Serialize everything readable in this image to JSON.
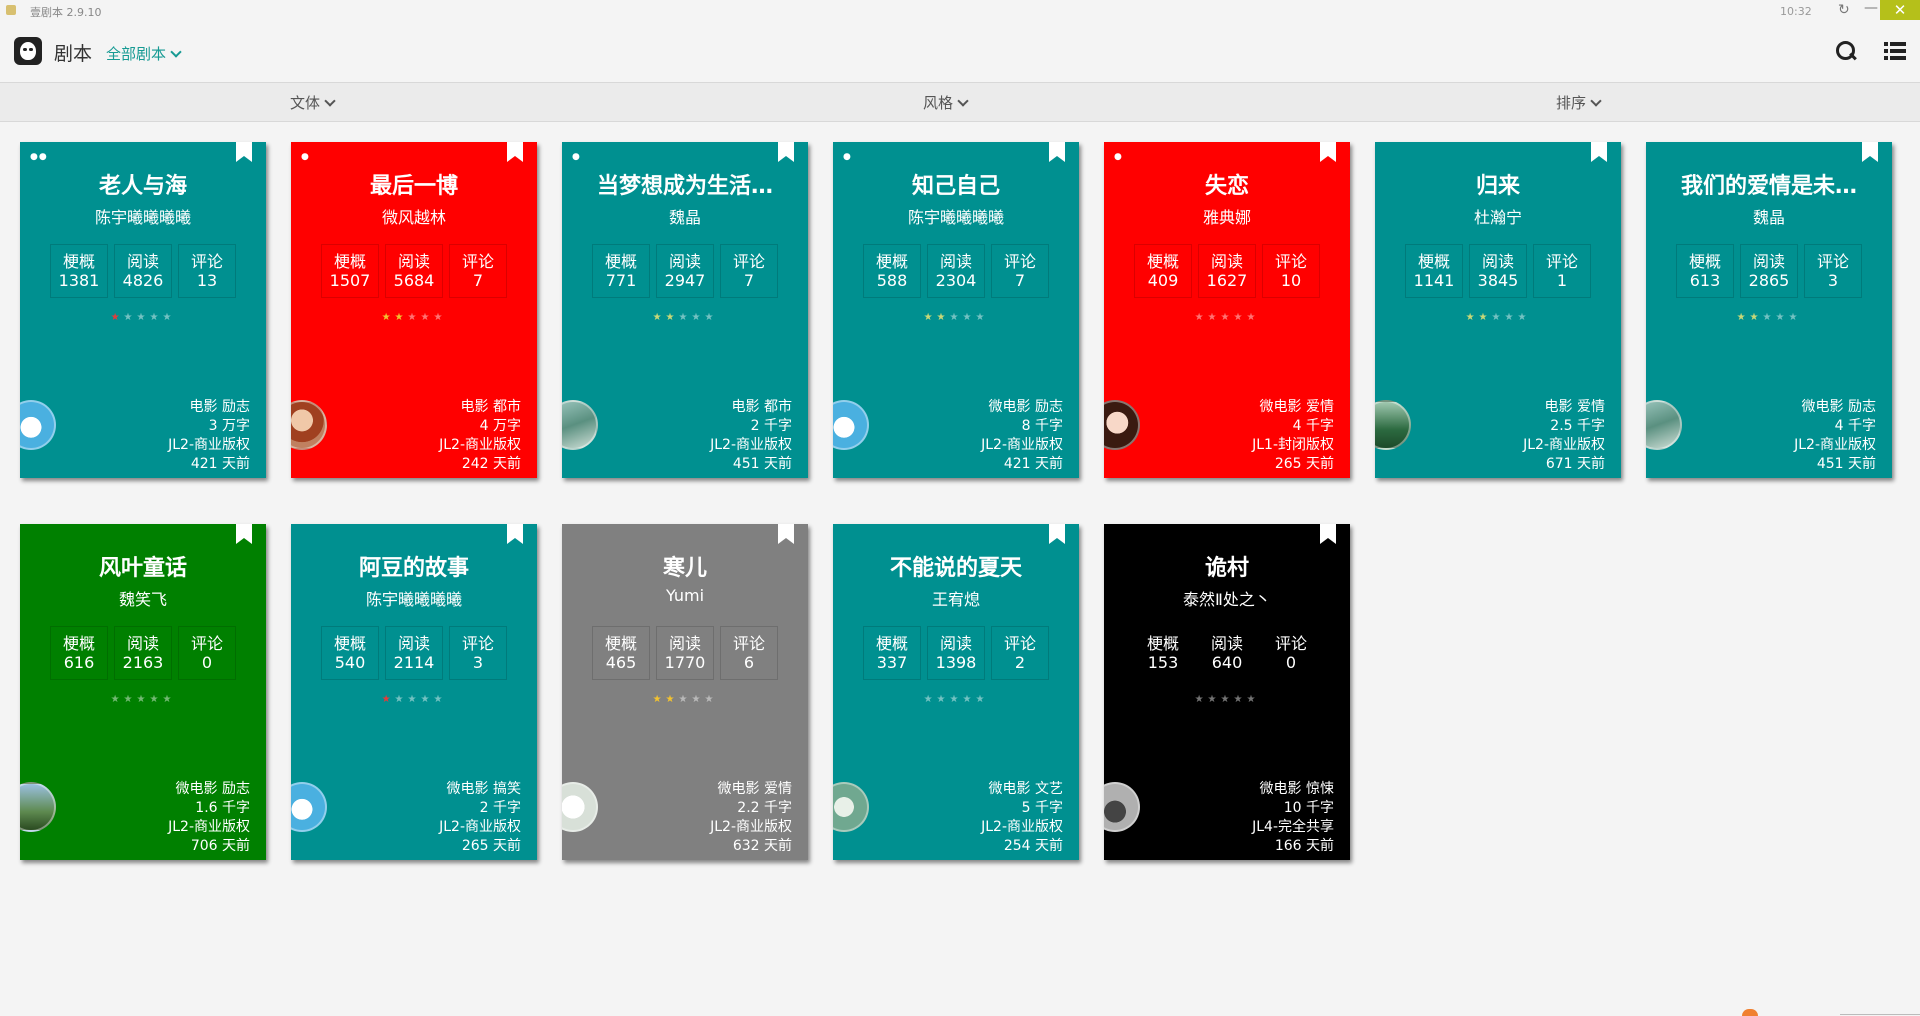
{
  "window": {
    "app_title": "壹剧本 2.9.10",
    "clock": "10:32",
    "close_label": "✕",
    "refresh_label": "↻",
    "minimize_label": "—"
  },
  "header": {
    "title": "剧本",
    "filter_label": "全部剧本"
  },
  "filterbar": {
    "items": [
      {
        "label": "文体"
      },
      {
        "label": "风格"
      },
      {
        "label": "排序"
      }
    ]
  },
  "colors": {
    "teal": "#009090",
    "red": "#ff0000",
    "green": "#008000",
    "gray": "#808080",
    "black": "#000000",
    "accent": "#169a93"
  },
  "cards": [
    {
      "title": "老人与海",
      "author": "陈宇曦曦曦曦",
      "stats": [
        {
          "label": "梗概",
          "value": "1381"
        },
        {
          "label": "阅读",
          "value": "4826"
        },
        {
          "label": "评论",
          "value": "13"
        }
      ],
      "rating": 1,
      "rating_color": "#e23b3b",
      "dots": "●●",
      "meta": [
        "电影 励志",
        "3 万字",
        "JL2-商业版权",
        "421 天前"
      ],
      "bg": "#009090",
      "avatar": "doraemon"
    },
    {
      "title": "最后一博",
      "author": "微风越林",
      "stats": [
        {
          "label": "梗概",
          "value": "1507"
        },
        {
          "label": "阅读",
          "value": "5684"
        },
        {
          "label": "评论",
          "value": "7"
        }
      ],
      "rating": 2,
      "rating_color": "#f2c230",
      "dots": "●",
      "meta": [
        "电影 都市",
        "4 万字",
        "JL2-商业版权",
        "242 天前"
      ],
      "bg": "#ff0000",
      "avatar": "person"
    },
    {
      "title": "当梦想成为生活…",
      "author": "魏晶",
      "stats": [
        {
          "label": "梗概",
          "value": "771"
        },
        {
          "label": "阅读",
          "value": "2947"
        },
        {
          "label": "评论",
          "value": "7"
        }
      ],
      "rating": 2,
      "rating_color": "#c8d878",
      "dots": "●",
      "meta": [
        "电影 都市",
        "2 千字",
        "JL2-商业版权",
        "451 天前"
      ],
      "bg": "#009090",
      "avatar": "landscape"
    },
    {
      "title": "知己自己",
      "author": "陈宇曦曦曦曦",
      "stats": [
        {
          "label": "梗概",
          "value": "588"
        },
        {
          "label": "阅读",
          "value": "2304"
        },
        {
          "label": "评论",
          "value": "7"
        }
      ],
      "rating": 2,
      "rating_color": "#c8d878",
      "dots": "●",
      "meta": [
        "微电影 励志",
        "8 千字",
        "JL2-商业版权",
        "421 天前"
      ],
      "bg": "#009090",
      "avatar": "doraemon"
    },
    {
      "title": "失恋",
      "author": "雅典娜",
      "stats": [
        {
          "label": "梗概",
          "value": "409"
        },
        {
          "label": "阅读",
          "value": "1627"
        },
        {
          "label": "评论",
          "value": "10"
        }
      ],
      "rating": 0,
      "rating_color": "#ffffff",
      "dots": "●",
      "meta": [
        "微电影 爱情",
        "4 千字",
        "JL1-封闭版权",
        "265 天前"
      ],
      "bg": "#ff0000",
      "avatar": "girl"
    },
    {
      "title": "归来",
      "author": "杜瀚宁",
      "stats": [
        {
          "label": "梗概",
          "value": "1141"
        },
        {
          "label": "阅读",
          "value": "3845"
        },
        {
          "label": "评论",
          "value": "1"
        }
      ],
      "rating": 2,
      "rating_color": "#c8d878",
      "dots": "",
      "meta": [
        "电影 爱情",
        "2.5 千字",
        "JL2-商业版权",
        "671 天前"
      ],
      "bg": "#009090",
      "avatar": "forest"
    },
    {
      "title": "我们的爱情是未…",
      "author": "魏晶",
      "stats": [
        {
          "label": "梗概",
          "value": "613"
        },
        {
          "label": "阅读",
          "value": "2865"
        },
        {
          "label": "评论",
          "value": "3"
        }
      ],
      "rating": 2,
      "rating_color": "#c8d878",
      "dots": "",
      "meta": [
        "微电影 励志",
        "4 千字",
        "JL2-商业版权",
        "451 天前"
      ],
      "bg": "#009090",
      "avatar": "landscape"
    },
    {
      "title": "风叶童话",
      "author": "魏笑飞",
      "stats": [
        {
          "label": "梗概",
          "value": "616"
        },
        {
          "label": "阅读",
          "value": "2163"
        },
        {
          "label": "评论",
          "value": "0"
        }
      ],
      "rating": 0,
      "rating_color": "#ffffff",
      "dots": "",
      "meta": [
        "微电影 励志",
        "1.6 千字",
        "JL2-商业版权",
        "706 天前"
      ],
      "bg": "#008000",
      "avatar": "castle"
    },
    {
      "title": "阿豆的故事",
      "author": "陈宇曦曦曦曦",
      "stats": [
        {
          "label": "梗概",
          "value": "540"
        },
        {
          "label": "阅读",
          "value": "2114"
        },
        {
          "label": "评论",
          "value": "3"
        }
      ],
      "rating": 1,
      "rating_color": "#e23b3b",
      "dots": "",
      "meta": [
        "微电影 搞笑",
        "2 千字",
        "JL2-商业版权",
        "265 天前"
      ],
      "bg": "#009090",
      "avatar": "doraemon"
    },
    {
      "title": "寒儿",
      "author": "Yumi",
      "stats": [
        {
          "label": "梗概",
          "value": "465"
        },
        {
          "label": "阅读",
          "value": "1770"
        },
        {
          "label": "评论",
          "value": "6"
        }
      ],
      "rating": 2,
      "rating_color": "#f2c230",
      "dots": "",
      "meta": [
        "微电影 爱情",
        "2.2 千字",
        "JL2-商业版权",
        "632 天前"
      ],
      "bg": "#808080",
      "avatar": "sketch"
    },
    {
      "title": "不能说的夏天",
      "author": "王宥熄",
      "stats": [
        {
          "label": "梗概",
          "value": "337"
        },
        {
          "label": "阅读",
          "value": "1398"
        },
        {
          "label": "评论",
          "value": "2"
        }
      ],
      "rating": 0,
      "rating_color": "#ffffff",
      "dots": "",
      "meta": [
        "微电影 文艺",
        "5 千字",
        "JL2-商业版权",
        "254 天前"
      ],
      "bg": "#009090",
      "avatar": "flower"
    },
    {
      "title": "诡村",
      "author": "泰然Ⅱ处之丶",
      "stats": [
        {
          "label": "梗概",
          "value": "153"
        },
        {
          "label": "阅读",
          "value": "640"
        },
        {
          "label": "评论",
          "value": "0"
        }
      ],
      "rating": 0,
      "rating_color": "#ffffff",
      "dots": "",
      "meta": [
        "微电影 惊悚",
        "10 千字",
        "JL4-完全共享",
        "166 天前"
      ],
      "bg": "#000000",
      "avatar": "dark"
    }
  ]
}
